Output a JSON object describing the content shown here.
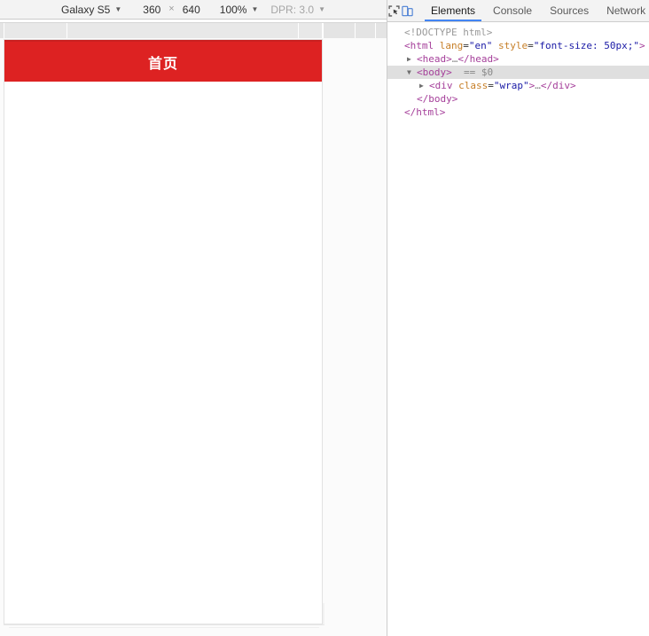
{
  "device_toolbar": {
    "device_name": "Galaxy S5",
    "device_caret": "▼",
    "width": "360",
    "separator": "×",
    "height": "640",
    "zoom": "100%",
    "zoom_caret": "▼",
    "dpr_label": "DPR: 3.0",
    "dpr_caret": "▼"
  },
  "emulated_page": {
    "header_title": "首页",
    "header_color": "#dd2222",
    "header_text_color": "#ffffff",
    "body_color": "#ffffff",
    "viewport_width": "360",
    "viewport_height": "640"
  },
  "devtools": {
    "icons": [
      {
        "name": "inspect-element-icon",
        "label": "Inspect element"
      },
      {
        "name": "device-toolbar-icon",
        "label": "Toggle device toolbar"
      }
    ],
    "tabs": [
      {
        "label": "Elements",
        "active": true
      },
      {
        "label": "Console",
        "active": false
      },
      {
        "label": "Sources",
        "active": false
      },
      {
        "label": "Network",
        "active": false
      }
    ],
    "accent_color": "#4285f4",
    "dom_tree": [
      {
        "id": "doctype",
        "indent": 1,
        "twisty": "",
        "tokens": [
          {
            "type": "doctype",
            "text": "<!DOCTYPE html>"
          }
        ]
      },
      {
        "id": "html-open",
        "indent": 1,
        "twisty": "",
        "tokens": [
          {
            "type": "punct",
            "text": "<"
          },
          {
            "type": "tag",
            "text": "html"
          },
          {
            "type": "eq",
            "text": " "
          },
          {
            "type": "attr",
            "text": "lang"
          },
          {
            "type": "eq",
            "text": "="
          },
          {
            "type": "val",
            "text": "\"en\""
          },
          {
            "type": "eq",
            "text": " "
          },
          {
            "type": "attr",
            "text": "style"
          },
          {
            "type": "eq",
            "text": "="
          },
          {
            "type": "val",
            "text": "\"font-size: 50px;\""
          },
          {
            "type": "punct",
            "text": ">"
          }
        ]
      },
      {
        "id": "head",
        "indent": 2,
        "twisty": "▶",
        "tokens": [
          {
            "type": "punct",
            "text": "<"
          },
          {
            "type": "tag",
            "text": "head"
          },
          {
            "type": "punct",
            "text": ">"
          },
          {
            "type": "ellipsis",
            "text": "…"
          },
          {
            "type": "punct",
            "text": "</"
          },
          {
            "type": "tag",
            "text": "head"
          },
          {
            "type": "punct",
            "text": ">"
          }
        ]
      },
      {
        "id": "body-open",
        "indent": 2,
        "twisty": "▼",
        "selected": true,
        "tokens": [
          {
            "type": "punct",
            "text": "<"
          },
          {
            "type": "tag",
            "text": "body"
          },
          {
            "type": "punct",
            "text": ">"
          },
          {
            "type": "sel",
            "text": "  == $0"
          }
        ]
      },
      {
        "id": "div-wrap",
        "indent": 3,
        "twisty": "▶",
        "tokens": [
          {
            "type": "punct",
            "text": "<"
          },
          {
            "type": "tag",
            "text": "div"
          },
          {
            "type": "eq",
            "text": " "
          },
          {
            "type": "attr",
            "text": "class"
          },
          {
            "type": "eq",
            "text": "="
          },
          {
            "type": "val",
            "text": "\"wrap\""
          },
          {
            "type": "punct",
            "text": ">"
          },
          {
            "type": "ellipsis",
            "text": "…"
          },
          {
            "type": "punct",
            "text": "</"
          },
          {
            "type": "tag",
            "text": "div"
          },
          {
            "type": "punct",
            "text": ">"
          }
        ]
      },
      {
        "id": "body-close",
        "indent": 2,
        "twisty": "",
        "tokens": [
          {
            "type": "punct",
            "text": "</"
          },
          {
            "type": "tag",
            "text": "body"
          },
          {
            "type": "punct",
            "text": ">"
          }
        ]
      },
      {
        "id": "html-close",
        "indent": 1,
        "twisty": "",
        "tokens": [
          {
            "type": "punct",
            "text": "</"
          },
          {
            "type": "tag",
            "text": "html"
          },
          {
            "type": "punct",
            "text": ">"
          }
        ]
      }
    ]
  }
}
